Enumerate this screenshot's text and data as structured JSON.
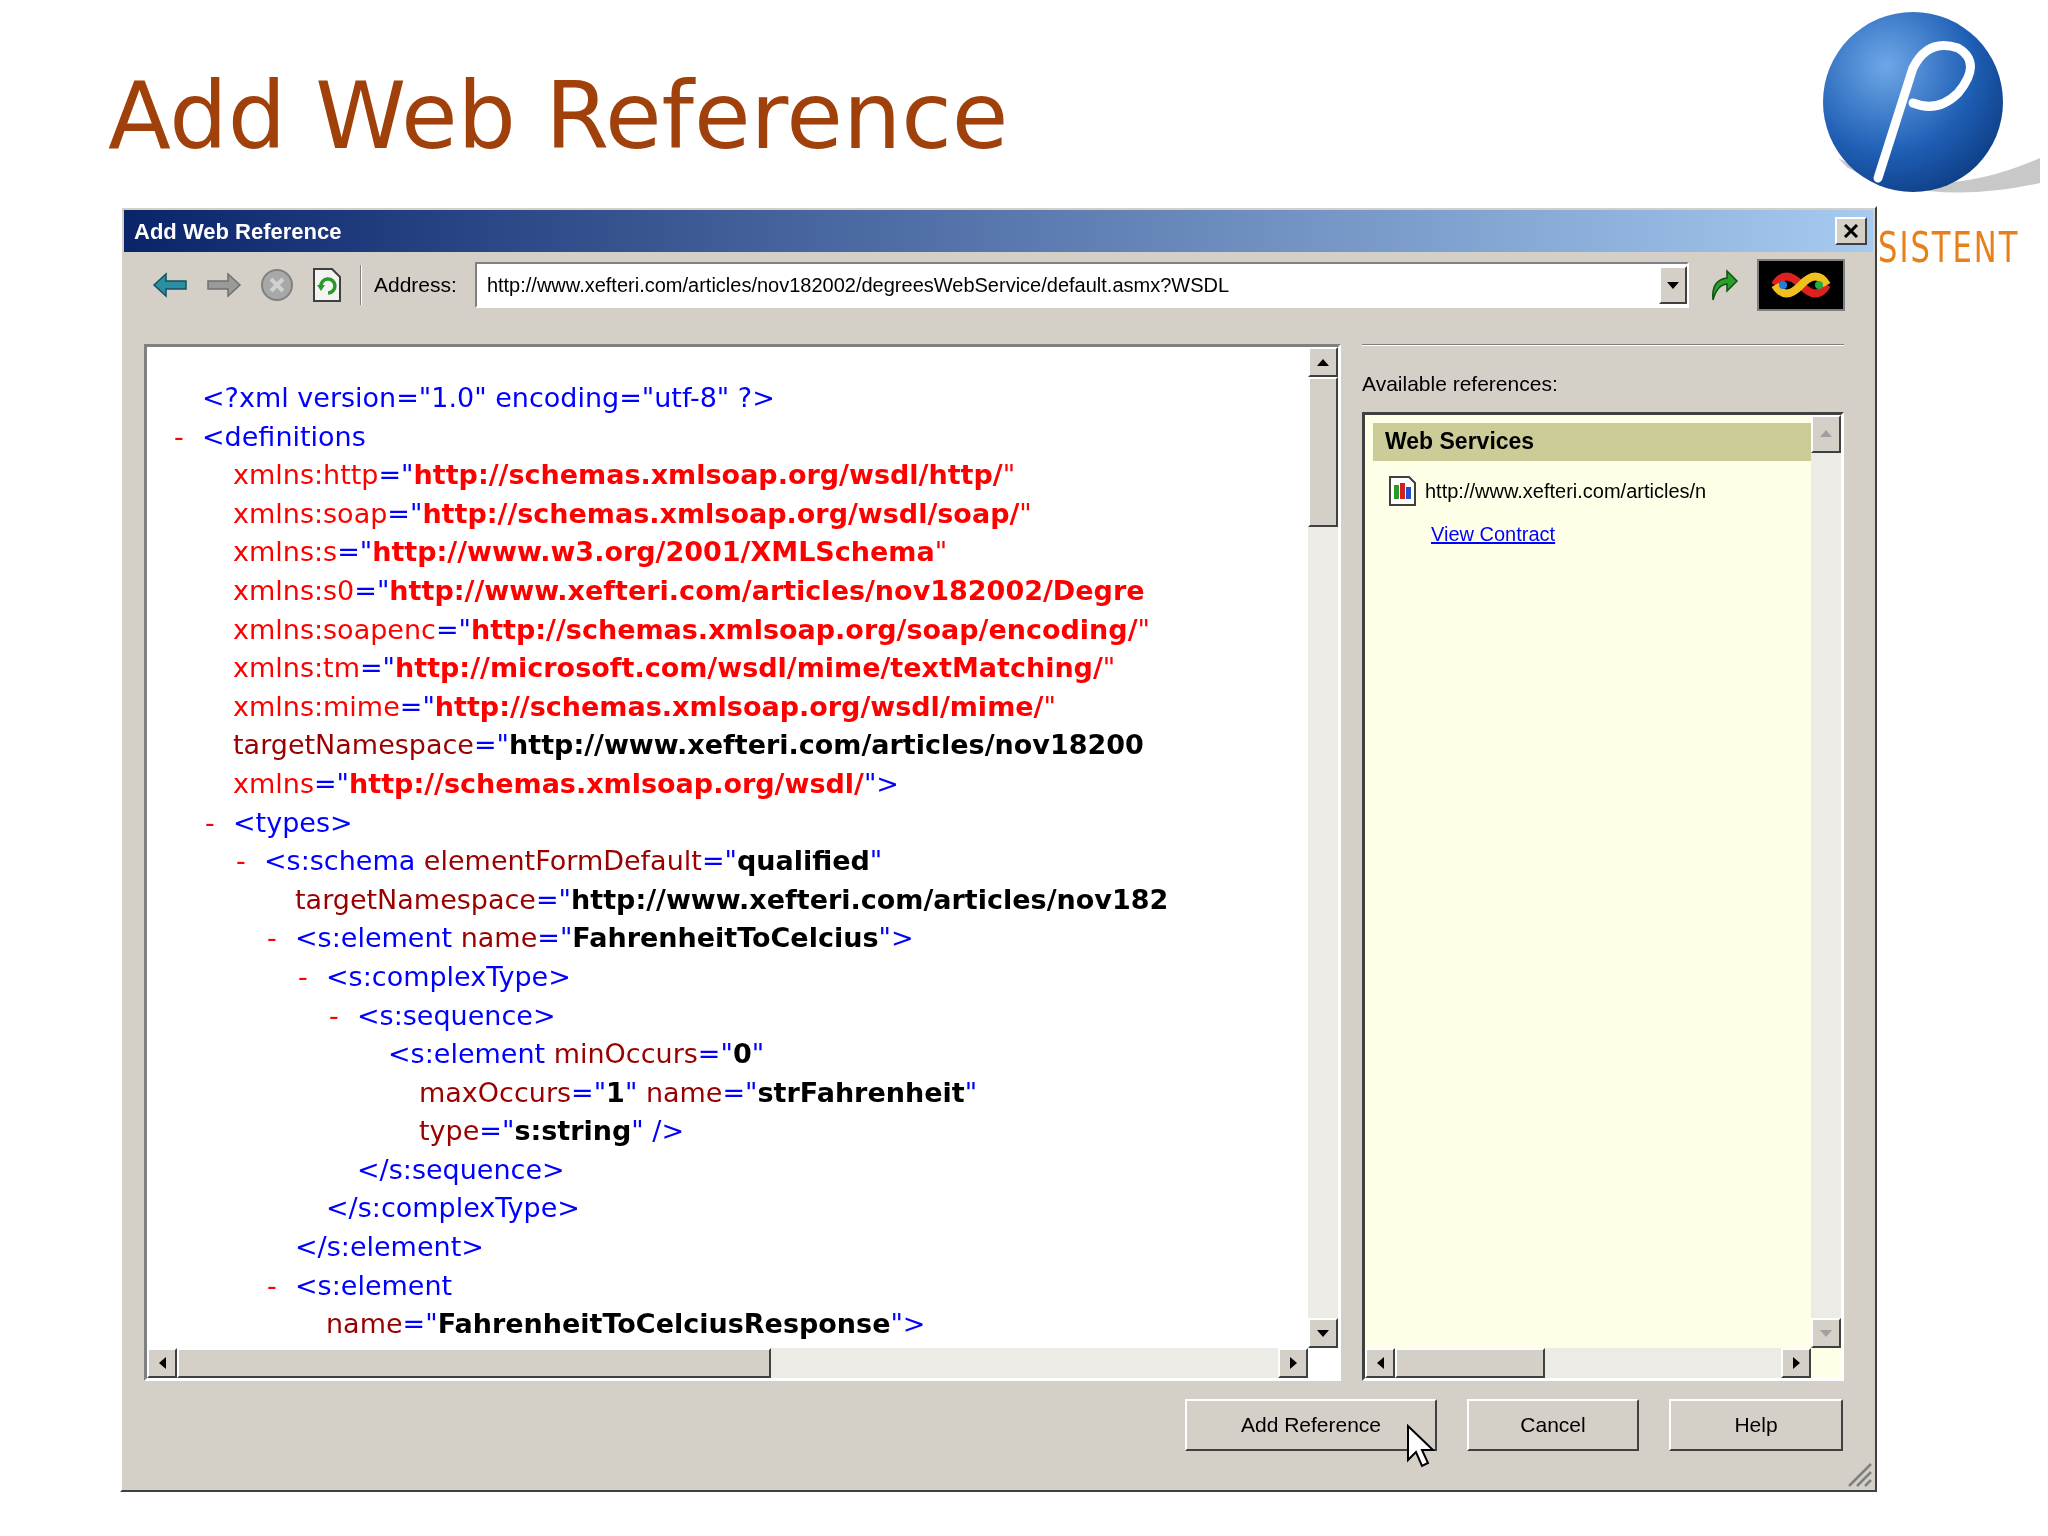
{
  "slide_title": "Add Web Reference",
  "logo_text": "SISTENT",
  "window": {
    "title": "Add Web Reference"
  },
  "toolbar": {
    "address_label": "Address:",
    "address": "http://www.xefteri.com/articles/nov182002/degreesWebService/default.asmx?WSDL"
  },
  "document": [
    {
      "lines": [
        [
          {
            "kind": "tag",
            "text": "<?xml version=\"1.0\" encoding=\"utf-8\" ?>"
          }
        ]
      ]
    },
    {
      "toggle": "-",
      "lines": [
        [
          {
            "kind": "tag",
            "text": "<definitions"
          }
        ],
        [
          {
            "kind": "ns",
            "text": "xmlns:http"
          },
          {
            "kind": "tag",
            "text": "=\""
          },
          {
            "kind": "nsval",
            "text": "http://schemas.xmlsoap.org/wsdl/http/"
          },
          {
            "kind": "ns",
            "text": "\""
          }
        ],
        [
          {
            "kind": "ns",
            "text": "xmlns:soap"
          },
          {
            "kind": "tag",
            "text": "=\""
          },
          {
            "kind": "nsval",
            "text": "http://schemas.xmlsoap.org/wsdl/soap/"
          },
          {
            "kind": "ns",
            "text": "\""
          }
        ],
        [
          {
            "kind": "ns",
            "text": "xmlns:s"
          },
          {
            "kind": "tag",
            "text": "=\""
          },
          {
            "kind": "nsval",
            "text": "http://www.w3.org/2001/XMLSchema"
          },
          {
            "kind": "ns",
            "text": "\""
          }
        ],
        [
          {
            "kind": "ns",
            "text": "xmlns:s0"
          },
          {
            "kind": "tag",
            "text": "=\""
          },
          {
            "kind": "nsval",
            "text": "http://www.xefteri.com/articles/nov182002/Degre"
          }
        ],
        [
          {
            "kind": "ns",
            "text": "xmlns:soapenc"
          },
          {
            "kind": "tag",
            "text": "=\""
          },
          {
            "kind": "nsval",
            "text": "http://schemas.xmlsoap.org/soap/encoding/"
          },
          {
            "kind": "ns",
            "text": "\""
          }
        ],
        [
          {
            "kind": "ns",
            "text": "xmlns:tm"
          },
          {
            "kind": "tag",
            "text": "=\""
          },
          {
            "kind": "nsval",
            "text": "http://microsoft.com/wsdl/mime/textMatching/"
          },
          {
            "kind": "ns",
            "text": "\""
          }
        ],
        [
          {
            "kind": "ns",
            "text": "xmlns:mime"
          },
          {
            "kind": "tag",
            "text": "=\""
          },
          {
            "kind": "nsval",
            "text": "http://schemas.xmlsoap.org/wsdl/mime/"
          },
          {
            "kind": "ns",
            "text": "\""
          }
        ],
        [
          {
            "kind": "attr",
            "text": "targetNamespace"
          },
          {
            "kind": "tag",
            "text": "=\""
          },
          {
            "kind": "val",
            "text": "http://www.xefteri.com/articles/nov18200"
          }
        ],
        [
          {
            "kind": "ns",
            "text": "xmlns"
          },
          {
            "kind": "tag",
            "text": "=\""
          },
          {
            "kind": "nsval",
            "text": "http://schemas.xmlsoap.org/wsdl/"
          },
          {
            "kind": "tag",
            "text": "\">"
          }
        ]
      ],
      "children": [
        {
          "toggle": "-",
          "lines": [
            [
              {
                "kind": "tag",
                "text": "<types>"
              }
            ]
          ],
          "children": [
            {
              "toggle": "-",
              "lines": [
                [
                  {
                    "kind": "tag",
                    "text": "<s:schema"
                  },
                  {
                    "kind": "attr",
                    "text": " elementFormDefault"
                  },
                  {
                    "kind": "tag",
                    "text": "=\""
                  },
                  {
                    "kind": "val",
                    "text": "qualified"
                  },
                  {
                    "kind": "tag",
                    "text": "\""
                  }
                ],
                [
                  {
                    "kind": "attr",
                    "text": "targetNamespace"
                  },
                  {
                    "kind": "tag",
                    "text": "=\""
                  },
                  {
                    "kind": "val",
                    "text": "http://www.xefteri.com/articles/nov182"
                  }
                ]
              ],
              "children": [
                {
                  "toggle": "-",
                  "lines": [
                    [
                      {
                        "kind": "tag",
                        "text": "<s:element"
                      },
                      {
                        "kind": "attr",
                        "text": " name"
                      },
                      {
                        "kind": "tag",
                        "text": "=\""
                      },
                      {
                        "kind": "val",
                        "text": "FahrenheitToCelcius"
                      },
                      {
                        "kind": "tag",
                        "text": "\">"
                      }
                    ]
                  ],
                  "children": [
                    {
                      "toggle": "-",
                      "lines": [
                        [
                          {
                            "kind": "tag",
                            "text": "<s:complexType>"
                          }
                        ]
                      ],
                      "children": [
                        {
                          "toggle": "-",
                          "lines": [
                            [
                              {
                                "kind": "tag",
                                "text": "<s:sequence>"
                              }
                            ]
                          ],
                          "children": [
                            {
                              "lines": [
                                [
                                  {
                                    "kind": "tag",
                                    "text": "<s:element"
                                  },
                                  {
                                    "kind": "attr",
                                    "text": " minOccurs"
                                  },
                                  {
                                    "kind": "tag",
                                    "text": "=\""
                                  },
                                  {
                                    "kind": "val",
                                    "text": "0"
                                  },
                                  {
                                    "kind": "tag",
                                    "text": "\""
                                  }
                                ],
                                [
                                  {
                                    "kind": "attr",
                                    "text": "maxOccurs"
                                  },
                                  {
                                    "kind": "tag",
                                    "text": "=\""
                                  },
                                  {
                                    "kind": "val",
                                    "text": "1"
                                  },
                                  {
                                    "kind": "tag",
                                    "text": "\""
                                  },
                                  {
                                    "kind": "attr",
                                    "text": " name"
                                  },
                                  {
                                    "kind": "tag",
                                    "text": "=\""
                                  },
                                  {
                                    "kind": "val",
                                    "text": "strFahrenheit"
                                  },
                                  {
                                    "kind": "tag",
                                    "text": "\""
                                  }
                                ],
                                [
                                  {
                                    "kind": "attr",
                                    "text": "type"
                                  },
                                  {
                                    "kind": "tag",
                                    "text": "=\""
                                  },
                                  {
                                    "kind": "val",
                                    "text": "s:string"
                                  },
                                  {
                                    "kind": "tag",
                                    "text": "\" />"
                                  }
                                ]
                              ]
                            }
                          ],
                          "close": [
                            {
                              "kind": "tag",
                              "text": "</s:sequence>"
                            }
                          ]
                        }
                      ],
                      "close": [
                        {
                          "kind": "tag",
                          "text": "</s:complexType>"
                        }
                      ]
                    }
                  ],
                  "close": [
                    {
                      "kind": "tag",
                      "text": "</s:element>"
                    }
                  ]
                },
                {
                  "toggle": "-",
                  "lines": [
                    [
                      {
                        "kind": "tag",
                        "text": "<s:element"
                      }
                    ],
                    [
                      {
                        "kind": "attr",
                        "text": "name"
                      },
                      {
                        "kind": "tag",
                        "text": "=\""
                      },
                      {
                        "kind": "val",
                        "text": "FahrenheitToCelciusResponse"
                      },
                      {
                        "kind": "tag",
                        "text": "\">"
                      }
                    ]
                  ]
                }
              ]
            }
          ]
        }
      ]
    }
  ],
  "references": {
    "label": "Available references:",
    "group": "Web Services",
    "items": [
      {
        "url": "http://www.xefteri.com/articles/n",
        "link": "View Contract"
      }
    ]
  },
  "buttons": [
    "Add Reference",
    "Cancel",
    "Help"
  ]
}
